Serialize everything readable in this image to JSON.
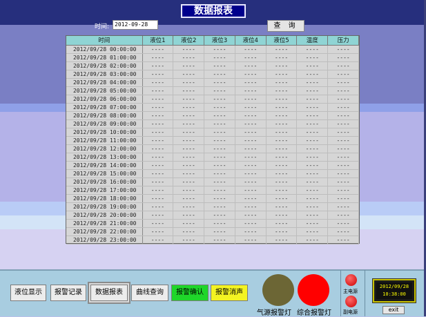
{
  "title": "数据报表",
  "query": {
    "date_label": "时间:",
    "date_value": "2012-09-28",
    "query_label": "查 询"
  },
  "report": {
    "columns": [
      "时间",
      "液位1",
      "液位2",
      "液位3",
      "液位4",
      "液位5",
      "温度",
      "压力"
    ],
    "rows": [
      [
        "2012/09/28 00:00:00",
        "----",
        "----",
        "----",
        "----",
        "----",
        "----",
        "----"
      ],
      [
        "2012/09/28 01:00:00",
        "----",
        "----",
        "----",
        "----",
        "----",
        "----",
        "----"
      ],
      [
        "2012/09/28 02:00:00",
        "----",
        "----",
        "----",
        "----",
        "----",
        "----",
        "----"
      ],
      [
        "2012/09/28 03:00:00",
        "----",
        "----",
        "----",
        "----",
        "----",
        "----",
        "----"
      ],
      [
        "2012/09/28 04:00:00",
        "----",
        "----",
        "----",
        "----",
        "----",
        "----",
        "----"
      ],
      [
        "2012/09/28 05:00:00",
        "----",
        "----",
        "----",
        "----",
        "----",
        "----",
        "----"
      ],
      [
        "2012/09/28 06:00:00",
        "----",
        "----",
        "----",
        "----",
        "----",
        "----",
        "----"
      ],
      [
        "2012/09/28 07:00:00",
        "----",
        "----",
        "----",
        "----",
        "----",
        "----",
        "----"
      ],
      [
        "2012/09/28 08:00:00",
        "----",
        "----",
        "----",
        "----",
        "----",
        "----",
        "----"
      ],
      [
        "2012/09/28 09:00:00",
        "----",
        "----",
        "----",
        "----",
        "----",
        "----",
        "----"
      ],
      [
        "2012/09/28 10:00:00",
        "----",
        "----",
        "----",
        "----",
        "----",
        "----",
        "----"
      ],
      [
        "2012/09/28 11:00:00",
        "----",
        "----",
        "----",
        "----",
        "----",
        "----",
        "----"
      ],
      [
        "2012/09/28 12:00:00",
        "----",
        "----",
        "----",
        "----",
        "----",
        "----",
        "----"
      ],
      [
        "2012/09/28 13:00:00",
        "----",
        "----",
        "----",
        "----",
        "----",
        "----",
        "----"
      ],
      [
        "2012/09/28 14:00:00",
        "----",
        "----",
        "----",
        "----",
        "----",
        "----",
        "----"
      ],
      [
        "2012/09/28 15:00:00",
        "----",
        "----",
        "----",
        "----",
        "----",
        "----",
        "----"
      ],
      [
        "2012/09/28 16:00:00",
        "----",
        "----",
        "----",
        "----",
        "----",
        "----",
        "----"
      ],
      [
        "2012/09/28 17:00:00",
        "----",
        "----",
        "----",
        "----",
        "----",
        "----",
        "----"
      ],
      [
        "2012/09/28 18:00:00",
        "----",
        "----",
        "----",
        "----",
        "----",
        "----",
        "----"
      ],
      [
        "2012/09/28 19:00:00",
        "----",
        "----",
        "----",
        "----",
        "----",
        "----",
        "----"
      ],
      [
        "2012/09/28 20:00:00",
        "----",
        "----",
        "----",
        "----",
        "----",
        "----",
        "----"
      ],
      [
        "2012/09/28 21:00:00",
        "----",
        "----",
        "----",
        "----",
        "----",
        "----",
        "----"
      ],
      [
        "2012/09/28 22:00:00",
        "----",
        "----",
        "----",
        "----",
        "----",
        "----",
        "----"
      ],
      [
        "2012/09/28 23:00:00",
        "----",
        "----",
        "----",
        "----",
        "----",
        "----",
        "----"
      ]
    ]
  },
  "nav": {
    "level_display": "液位显示",
    "alarm_records": "报警记录",
    "data_report": "数据报表",
    "curve_query": "曲线查询",
    "alarm_ack": "报警确认",
    "alarm_silence": "报警消声"
  },
  "lamps": {
    "gas_alarm_label": "气源报警灯",
    "general_alarm_label": "综合报警灯",
    "main_power_label": "主电源",
    "backup_power_label": "副电源",
    "colors": {
      "gas": "#6c6635",
      "general": "#ff0000",
      "power": "#cc0000"
    }
  },
  "clock": {
    "date": "2012/09/28",
    "time": "10:38:00"
  },
  "exit_label": "exit",
  "colors": {
    "title_bg": "#00008c",
    "ack": "#1fd62a",
    "silence": "#f3f322",
    "header": "#8fd4d4"
  }
}
